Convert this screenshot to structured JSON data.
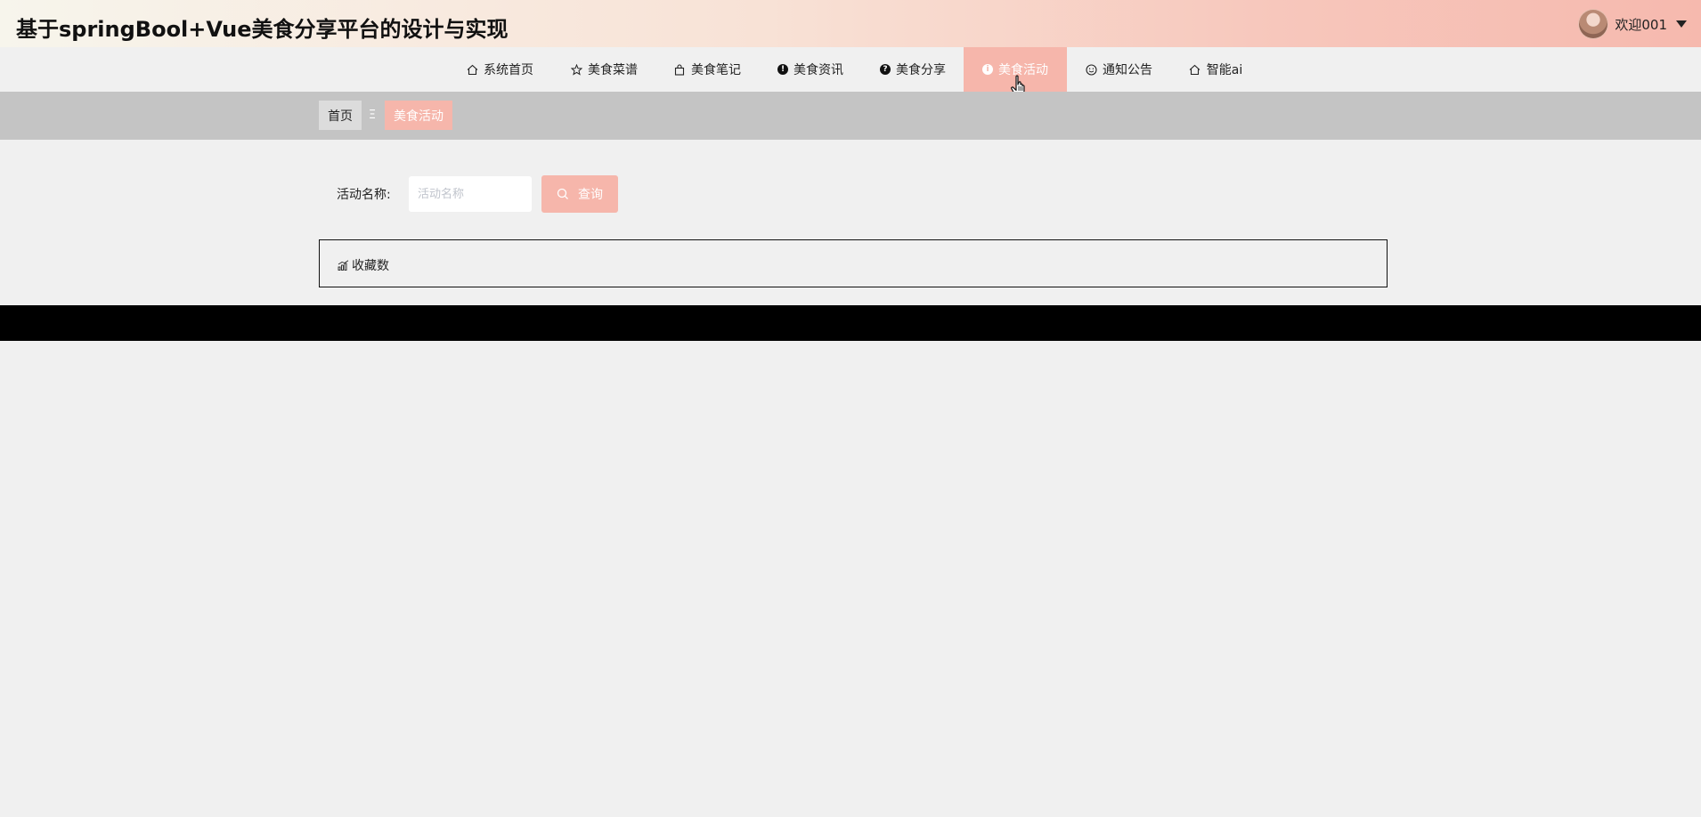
{
  "header": {
    "site_title": "基于springBool+Vue美食分享平台的设计与实现",
    "welcome_text": "欢迎001"
  },
  "nav": {
    "items": [
      {
        "label": "系统首页",
        "icon": "home-icon"
      },
      {
        "label": "美食菜谱",
        "icon": "star-icon"
      },
      {
        "label": "美食笔记",
        "icon": "bag-icon"
      },
      {
        "label": "美食资讯",
        "icon": "exclamation-circle-icon"
      },
      {
        "label": "美食分享",
        "icon": "question-circle-icon"
      },
      {
        "label": "美食活动",
        "icon": "info-circle-icon",
        "active": true
      },
      {
        "label": "通知公告",
        "icon": "smile-icon"
      },
      {
        "label": "智能ai",
        "icon": "home-icon"
      }
    ]
  },
  "breadcrumb": {
    "home": "首页",
    "separator": "Ξ",
    "current": "美食活动"
  },
  "search": {
    "label": "活动名称:",
    "placeholder": "活动名称",
    "value": "",
    "button_label": "查询"
  },
  "stats": {
    "favorites_label": "收藏数"
  },
  "colors": {
    "accent": "#f6b6ab",
    "breadcrumb_bar": "#c4c4c4",
    "page_background": "#f0f0f0",
    "footer": "#000000"
  }
}
